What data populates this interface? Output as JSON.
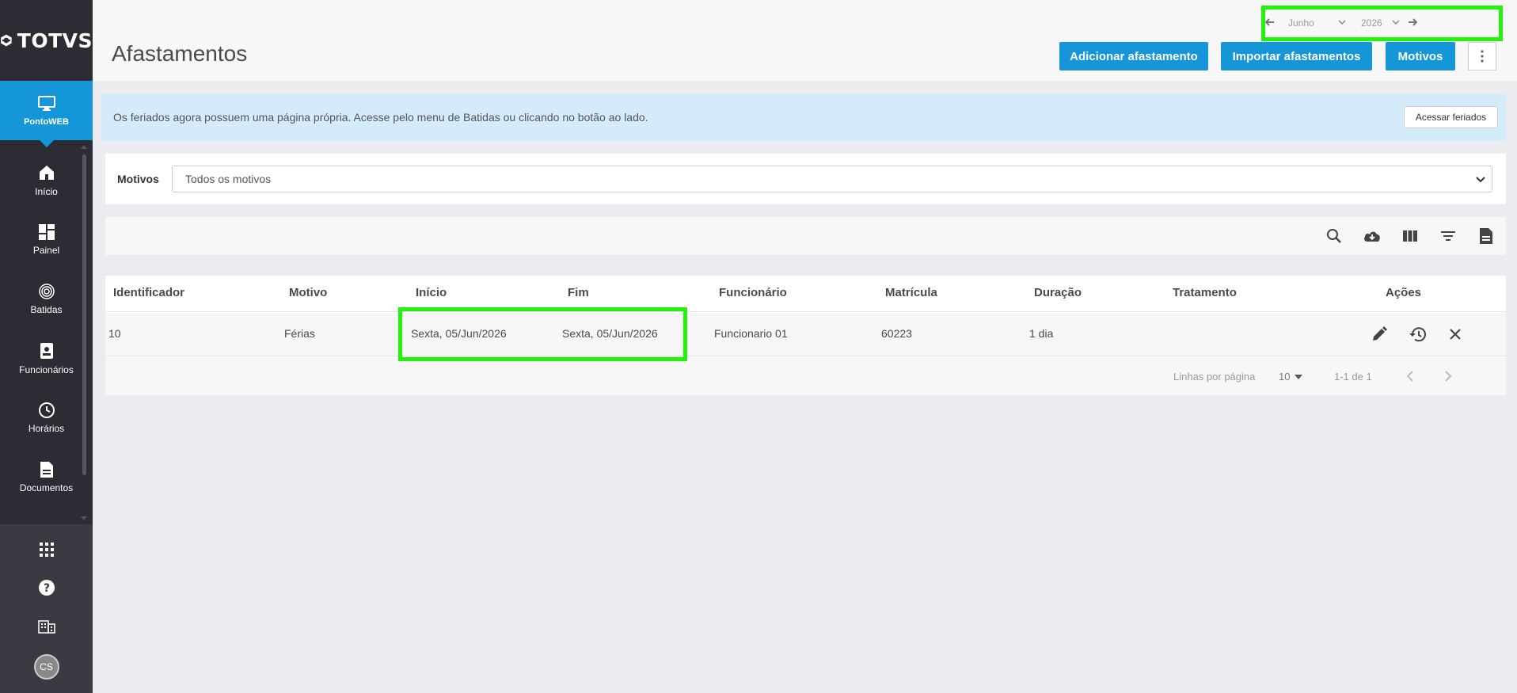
{
  "brand": {
    "logo_text": "TOTVS"
  },
  "app": {
    "label": "PontoWEB",
    "icon": "monitor-icon"
  },
  "nav": {
    "items": [
      {
        "label": "Início",
        "icon": "home-icon"
      },
      {
        "label": "Painel",
        "icon": "dashboard-icon"
      },
      {
        "label": "Batidas",
        "icon": "fingerprint-icon"
      },
      {
        "label": "Funcionários",
        "icon": "badge-icon"
      },
      {
        "label": "Horários",
        "icon": "clock-icon"
      },
      {
        "label": "Documentos",
        "icon": "document-icon"
      }
    ]
  },
  "sidebar_bottom": {
    "icons": [
      "apps-grid-icon",
      "help-icon",
      "building-icon"
    ],
    "avatar_initials": "CS"
  },
  "header": {
    "title": "Afastamentos",
    "period": {
      "month": "Junho",
      "year": "2026"
    },
    "buttons": {
      "add": "Adicionar afastamento",
      "import": "Importar afastamentos",
      "reasons": "Motivos"
    }
  },
  "banner": {
    "text": "Os feriados agora possuem uma página própria. Acesse pelo menu de Batidas ou clicando no botão ao lado.",
    "button": "Acessar feriados"
  },
  "filter": {
    "label": "Motivos",
    "selected": "Todos os motivos"
  },
  "toolbar": {
    "icons": [
      "search-icon",
      "download-cloud-icon",
      "columns-icon",
      "filter-icon",
      "report-icon"
    ]
  },
  "table": {
    "columns": [
      "Identificador",
      "Motivo",
      "Início",
      "Fim",
      "Funcionário",
      "Matrícula",
      "Duração",
      "Tratamento",
      "Ações"
    ],
    "rows": [
      {
        "identificador": "10",
        "motivo": "Férias",
        "inicio": "Sexta, 05/Jun/2026",
        "fim": "Sexta, 05/Jun/2026",
        "funcionario": "Funcionario 01",
        "matricula": "60223",
        "duracao": "1 dia",
        "tratamento": ""
      }
    ]
  },
  "pagination": {
    "rows_label": "Linhas por página",
    "rows_per_page": "10",
    "range": "1-1 de 1"
  },
  "colors": {
    "primary": "#1496d9",
    "sidebar": "#2b2c34",
    "highlight": "#22f20c",
    "banner": "#d4ecf9"
  }
}
